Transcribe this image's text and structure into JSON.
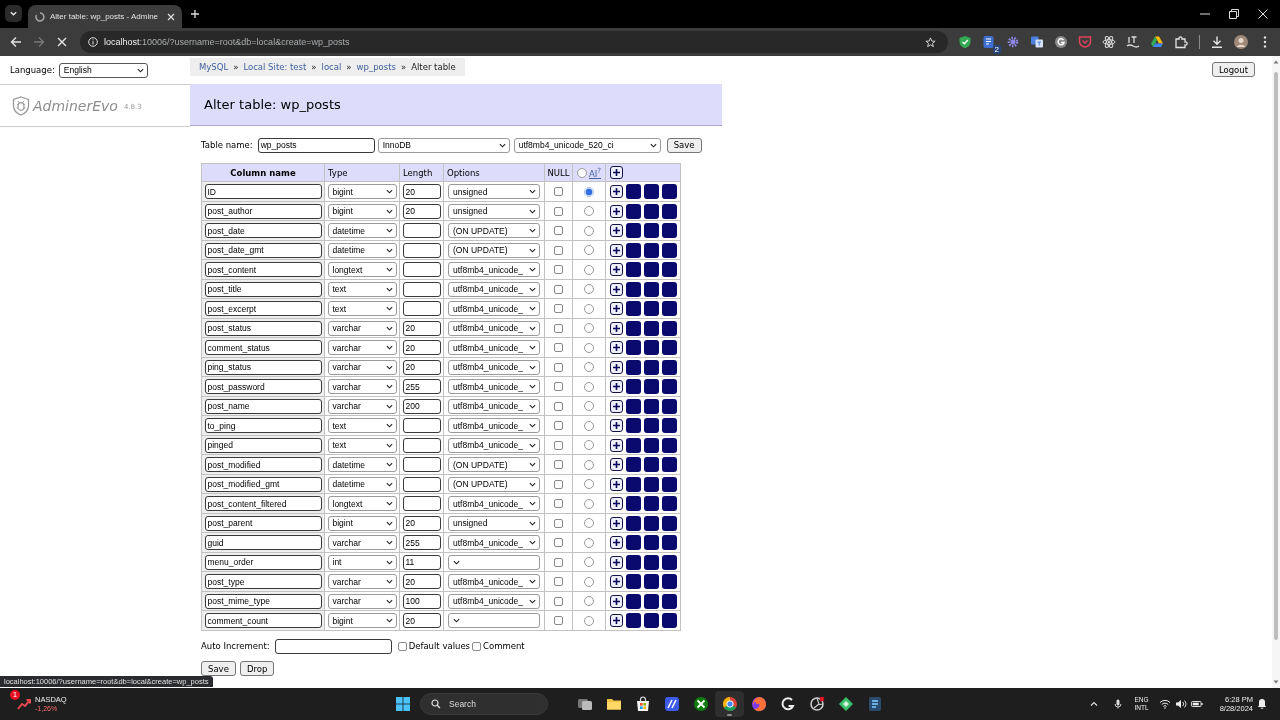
{
  "browser": {
    "tab_title": "Alter table: wp_posts - Admine",
    "url_host": "localhost",
    "url_path": ":10006/?username=root&db=local&create=wp_posts",
    "extension_badge": "2"
  },
  "sidebar": {
    "language_label": "Language:",
    "language": "English",
    "logo": "AdminerEvo",
    "version": "4.8.3"
  },
  "breadcrumb": [
    {
      "kind": "link",
      "label": "MySQL"
    },
    {
      "kind": "separator",
      "label": "»"
    },
    {
      "kind": "link",
      "label": "Local Site: test"
    },
    {
      "kind": "separator",
      "label": "»"
    },
    {
      "kind": "link",
      "label": "local"
    },
    {
      "kind": "separator",
      "label": "»"
    },
    {
      "kind": "link",
      "label": "wp_posts"
    },
    {
      "kind": "separator",
      "label": "»"
    },
    {
      "kind": "current",
      "label": "Alter table"
    }
  ],
  "logout": "Logout",
  "heading": "Alter table: wp_posts",
  "table_form": {
    "name_label": "Table name:",
    "name": "wp_posts",
    "engine": "InnoDB",
    "collation": "utf8mb4_unicode_520_ci",
    "save": "Save"
  },
  "columns": {
    "headers": [
      "Column name",
      "Type",
      "Length",
      "Options",
      "NULL"
    ],
    "ai_label": "AI$^{?}$",
    "ai_none_selected": false
  },
  "fields": [
    {
      "name": "ID",
      "type": "bigint",
      "length": "20",
      "options": "unsigned",
      "null": false,
      "ai_selected": true
    },
    {
      "name": "post_author",
      "type": "bigint",
      "length": "20",
      "options": "unsigned",
      "null": false,
      "ai_selected": false
    },
    {
      "name": "post_date",
      "type": "datetime",
      "options": "(ON UPDATE)",
      "null": false,
      "ai_selected": false
    },
    {
      "name": "post_date_gmt",
      "type": "datetime",
      "options": "(ON UPDATE)",
      "null": false,
      "ai_selected": false
    },
    {
      "name": "post_content",
      "type": "longtext",
      "options": "utf8mb4_unicode_",
      "null": false,
      "ai_selected": false
    },
    {
      "name": "post_title",
      "type": "text",
      "options": "utf8mb4_unicode_",
      "null": false,
      "ai_selected": false
    },
    {
      "name": "post_excerpt",
      "type": "text",
      "options": "utf8mb4_unicode_",
      "null": false,
      "ai_selected": false
    },
    {
      "name": "post_status",
      "type": "varchar",
      "length": "20",
      "options": "utf8mb4_unicode_",
      "null": false,
      "ai_selected": false
    },
    {
      "name": "comment_status",
      "type": "varchar",
      "length": "20",
      "options": "utf8mb4_unicode_",
      "null": false,
      "ai_selected": false
    },
    {
      "name": "ping_status",
      "type": "varchar",
      "length": "20",
      "options": "utf8mb4_unicode_",
      "null": false,
      "ai_selected": false
    },
    {
      "name": "post_password",
      "type": "varchar",
      "length": "255",
      "options": "utf8mb4_unicode_",
      "null": false,
      "ai_selected": false
    },
    {
      "name": "post_name",
      "type": "varchar",
      "length": "200",
      "options": "utf8mb4_unicode_",
      "null": false,
      "ai_selected": false
    },
    {
      "name": "to_ping",
      "type": "text",
      "options": "utf8mb4_unicode_",
      "null": false,
      "ai_selected": false
    },
    {
      "name": "pinged",
      "type": "text",
      "options": "utf8mb4_unicode_",
      "null": false,
      "ai_selected": false
    },
    {
      "name": "post_modified",
      "type": "datetime",
      "options": "(ON UPDATE)",
      "null": false,
      "ai_selected": false
    },
    {
      "name": "post_modified_gmt",
      "type": "datetime",
      "options": "(ON UPDATE)",
      "null": false,
      "ai_selected": false
    },
    {
      "name": "post_content_filtered",
      "type": "longtext",
      "options": "utf8mb4_unicode_",
      "null": false,
      "ai_selected": false
    },
    {
      "name": "post_parent",
      "type": "bigint",
      "length": "20",
      "options": "unsigned",
      "null": false,
      "ai_selected": false
    },
    {
      "name": "guid",
      "type": "varchar",
      "length": "255",
      "options": "utf8mb4_unicode_",
      "null": false,
      "ai_selected": false
    },
    {
      "name": "menu_order",
      "type": "int",
      "length": "11",
      "null": false,
      "ai_selected": false
    },
    {
      "name": "post_type",
      "type": "varchar",
      "length": "20",
      "options": "utf8mb4_unicode_",
      "null": false,
      "ai_selected": false
    },
    {
      "name": "post_mime_type",
      "type": "varchar",
      "length": "100",
      "options": "utf8mb4_unicode_",
      "null": false,
      "ai_selected": false
    },
    {
      "name": "comment_count",
      "type": "bigint",
      "length": "20",
      "null": false,
      "ai_selected": false
    }
  ],
  "footer": {
    "auto_increment_label": "Auto Increment:",
    "default_values": {
      "label": "Default values",
      "checked": false
    },
    "comment": {
      "label": "Comment",
      "checked": false
    },
    "buttons": [
      "Save",
      "Drop"
    ]
  },
  "status_link": "localhost:10006/?username=root&db=local&create=wp_posts",
  "taskbar": {
    "ticker_badge": "1",
    "ticker_name": "NASDAQ",
    "ticker_change": "-1,26%",
    "search": "Search",
    "language": "ENG",
    "layout": "INTL",
    "time": "6:28 PM",
    "date": "8/28/2024"
  }
}
